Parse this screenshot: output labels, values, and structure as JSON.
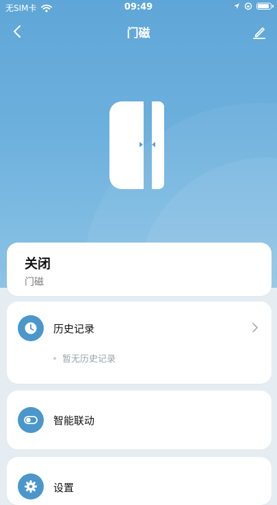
{
  "status_bar": {
    "carrier": "无SIM卡",
    "time": "09:49"
  },
  "nav": {
    "title": "门磁"
  },
  "device_card": {
    "state": "关闭",
    "device_name": "门磁"
  },
  "menu": {
    "history": {
      "label": "历史记录",
      "empty_text": "暂无历史记录"
    },
    "linkage": {
      "label": "智能联动"
    },
    "settings": {
      "label": "设置"
    }
  },
  "colors": {
    "hero_top": "#5fa6d8",
    "hero_bottom": "#8cc3e6",
    "accent": "#4b97cc",
    "page_bg": "#e6edf2"
  },
  "icons": {
    "back": "chevron-left-icon",
    "edit": "pencil-icon",
    "history": "clock-icon",
    "linkage": "toggle-icon",
    "settings": "gear-icon",
    "row_arrow": "chevron-right-icon"
  }
}
